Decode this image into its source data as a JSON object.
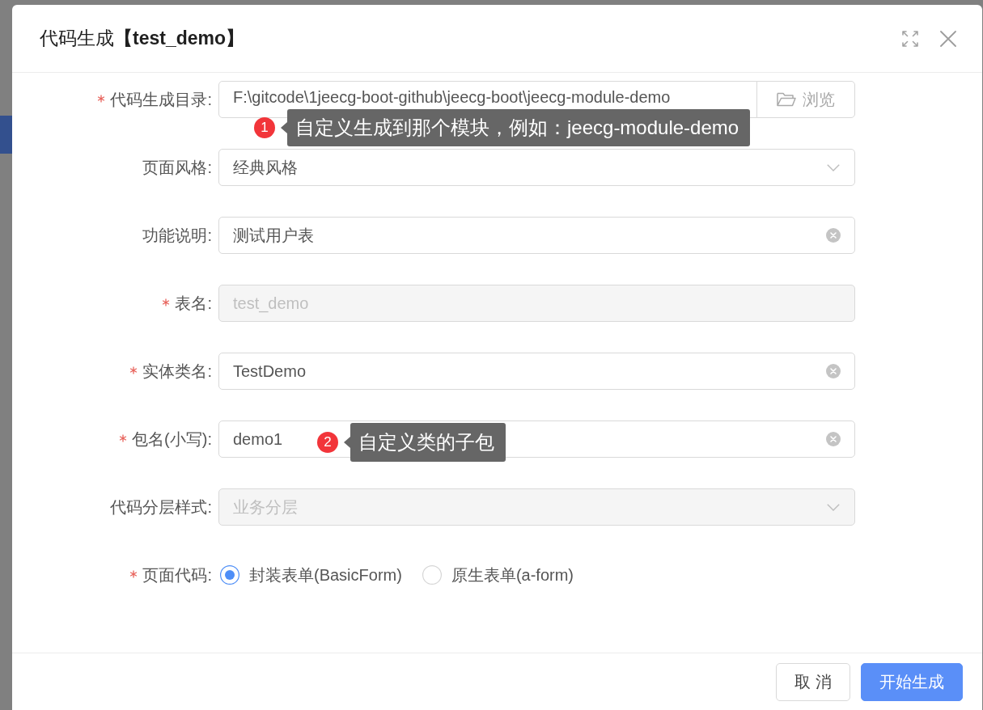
{
  "dialog": {
    "title": "代码生成**【test_demo】**"
  },
  "fields": [
    {
      "kind": "path",
      "label": "代码生成目录:",
      "required": true,
      "disabled": false,
      "value": "F:\\gitcode\\1jeecg-boot-github\\jeecg-boot\\jeecg-module-demo",
      "button": "浏览",
      "tip": {
        "number": "1",
        "text": "自定义生成到那个模块，例如：jeecg-module-demo"
      }
    },
    {
      "kind": "select",
      "label": "页面风格:",
      "required": false,
      "disabled": false,
      "value": "经典风格"
    },
    {
      "kind": "input",
      "label": "功能说明:",
      "required": false,
      "disabled": false,
      "clearable": true,
      "value": "测试用户表"
    },
    {
      "kind": "input",
      "label": "表名:",
      "required": true,
      "disabled": true,
      "clearable": false,
      "value": "test_demo"
    },
    {
      "kind": "input",
      "label": "实体类名:",
      "required": true,
      "disabled": false,
      "clearable": true,
      "value": "TestDemo"
    },
    {
      "kind": "input",
      "label": "包名(小写):",
      "required": true,
      "disabled": false,
      "clearable": true,
      "value": "demo1",
      "tip": {
        "number": "2",
        "text": "自定义类的子包"
      }
    },
    {
      "kind": "select",
      "label": "代码分层样式:",
      "required": false,
      "disabled": true,
      "value": "业务分层"
    },
    {
      "kind": "radio",
      "label": "页面代码:",
      "required": true,
      "disabled": false,
      "options": [
        {
          "label": "封装表单(BasicForm)",
          "selected": true
        },
        {
          "label": "原生表单(a-form)",
          "selected": false
        }
      ]
    }
  ],
  "footer": {
    "buttons": [
      {
        "kind": "default",
        "label": "取 消"
      },
      {
        "kind": "primary",
        "label": "开始生成"
      }
    ]
  }
}
